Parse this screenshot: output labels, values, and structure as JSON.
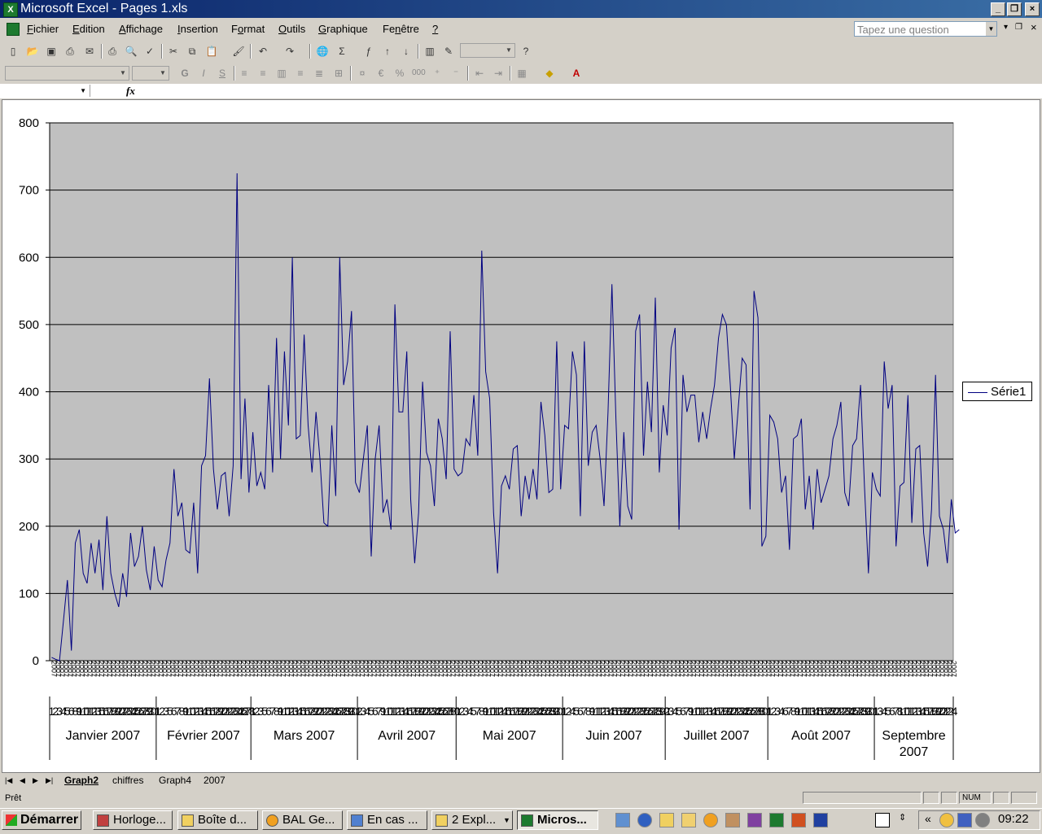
{
  "window": {
    "title": "Microsoft Excel - Pages 1.xls",
    "app_icon": "excel-icon"
  },
  "menu": {
    "items": [
      {
        "label": "Fichier",
        "hot": "F"
      },
      {
        "label": "Edition",
        "hot": "E"
      },
      {
        "label": "Affichage",
        "hot": "A"
      },
      {
        "label": "Insertion",
        "hot": "I"
      },
      {
        "label": "Format",
        "hot": "o"
      },
      {
        "label": "Outils",
        "hot": "O"
      },
      {
        "label": "Graphique",
        "hot": "G"
      },
      {
        "label": "Fenêtre",
        "hot": "n"
      },
      {
        "label": "?",
        "hot": "?"
      }
    ],
    "help_placeholder": "Tapez une question"
  },
  "format_toolbar": {
    "bold": "G",
    "italic": "I",
    "underline": "S",
    "euro": "€",
    "percent": "%",
    "thousands": "000"
  },
  "formula_bar": {
    "fx": "fx"
  },
  "sheet_tabs": [
    "Graph2",
    "chiffres",
    "Graph4",
    "2007"
  ],
  "active_tab": "Graph2",
  "status": {
    "text": "Prêt",
    "num": "NUM"
  },
  "taskbar": {
    "start": "Démarrer",
    "buttons": [
      "Horloge...",
      "Boîte d...",
      "BAL Ge...",
      "En cas ...",
      "2 Expl...",
      "Micros..."
    ],
    "clock": "09:22"
  },
  "chart_data": {
    "type": "line",
    "legend_position": "right",
    "grid": true,
    "ylim": [
      0,
      800
    ],
    "yticks": [
      0,
      100,
      200,
      300,
      400,
      500,
      600,
      700,
      800
    ],
    "months": [
      "Janvier 2007",
      "Février 2007",
      "Mars 2007",
      "Avril 2007",
      "Mai 2007",
      "Juin 2007",
      "Juillet 2007",
      "Août 2007",
      "Septembre 2007"
    ],
    "x": [
      "2007-01-01",
      "2007-01-02",
      "2007-01-03",
      "2007-01-04",
      "2007-01-05",
      "2007-01-06",
      "2007-01-08",
      "2007-01-09",
      "2007-01-10",
      "2007-01-11",
      "2007-01-12",
      "2007-01-13",
      "2007-01-15",
      "2007-01-16",
      "2007-01-17",
      "2007-01-18",
      "2007-01-19",
      "2007-01-20",
      "2007-01-22",
      "2007-01-23",
      "2007-01-24",
      "2007-01-25",
      "2007-01-26",
      "2007-01-27",
      "2007-01-29",
      "2007-01-30",
      "2007-01-31",
      "2007-02-01",
      "2007-02-02",
      "2007-02-03",
      "2007-02-05",
      "2007-02-06",
      "2007-02-07",
      "2007-02-08",
      "2007-02-09",
      "2007-02-10",
      "2007-02-12",
      "2007-02-13",
      "2007-02-14",
      "2007-02-15",
      "2007-02-16",
      "2007-02-17",
      "2007-02-19",
      "2007-02-20",
      "2007-02-21",
      "2007-02-22",
      "2007-02-23",
      "2007-02-24",
      "2007-02-26",
      "2007-02-27",
      "2007-02-28",
      "2007-03-01",
      "2007-03-02",
      "2007-03-03",
      "2007-03-05",
      "2007-03-06",
      "2007-03-07",
      "2007-03-08",
      "2007-03-09",
      "2007-03-10",
      "2007-03-12",
      "2007-03-13",
      "2007-03-14",
      "2007-03-15",
      "2007-03-16",
      "2007-03-17",
      "2007-03-19",
      "2007-03-20",
      "2007-03-21",
      "2007-03-22",
      "2007-03-23",
      "2007-03-24",
      "2007-03-26",
      "2007-03-27",
      "2007-03-28",
      "2007-03-29",
      "2007-03-30",
      "2007-03-31",
      "2007-04-02",
      "2007-04-03",
      "2007-04-04",
      "2007-04-05",
      "2007-04-06",
      "2007-04-07",
      "2007-04-09",
      "2007-04-10",
      "2007-04-11",
      "2007-04-12",
      "2007-04-13",
      "2007-04-14",
      "2007-04-16",
      "2007-04-17",
      "2007-04-18",
      "2007-04-19",
      "2007-04-20",
      "2007-04-21",
      "2007-04-23",
      "2007-04-24",
      "2007-04-25",
      "2007-04-26",
      "2007-04-27",
      "2007-04-28",
      "2007-04-30",
      "2007-05-01",
      "2007-05-02",
      "2007-05-03",
      "2007-05-04",
      "2007-05-05",
      "2007-05-07",
      "2007-05-08",
      "2007-05-09",
      "2007-05-10",
      "2007-05-11",
      "2007-05-12",
      "2007-05-14",
      "2007-05-15",
      "2007-05-16",
      "2007-05-17",
      "2007-05-18",
      "2007-05-19",
      "2007-05-21",
      "2007-05-22",
      "2007-05-23",
      "2007-05-24",
      "2007-05-25",
      "2007-05-26",
      "2007-05-28",
      "2007-05-29",
      "2007-05-30",
      "2007-05-31",
      "2007-06-01",
      "2007-06-02",
      "2007-06-04",
      "2007-06-05",
      "2007-06-06",
      "2007-06-07",
      "2007-06-08",
      "2007-06-09",
      "2007-06-11",
      "2007-06-12",
      "2007-06-13",
      "2007-06-14",
      "2007-06-15",
      "2007-06-16",
      "2007-06-18",
      "2007-06-19",
      "2007-06-20",
      "2007-06-21",
      "2007-06-22",
      "2007-06-23",
      "2007-06-25",
      "2007-06-26",
      "2007-06-27",
      "2007-06-28",
      "2007-06-29",
      "2007-06-30",
      "2007-07-02",
      "2007-07-03",
      "2007-07-04",
      "2007-07-05",
      "2007-07-06",
      "2007-07-07",
      "2007-07-09",
      "2007-07-10",
      "2007-07-11",
      "2007-07-12",
      "2007-07-13",
      "2007-07-14",
      "2007-07-16",
      "2007-07-17",
      "2007-07-18",
      "2007-07-19",
      "2007-07-20",
      "2007-07-21",
      "2007-07-23",
      "2007-07-24",
      "2007-07-25",
      "2007-07-26",
      "2007-07-27",
      "2007-07-28",
      "2007-07-30",
      "2007-07-31",
      "2007-08-01",
      "2007-08-02",
      "2007-08-03",
      "2007-08-04",
      "2007-08-06",
      "2007-08-07",
      "2007-08-08",
      "2007-08-09",
      "2007-08-10",
      "2007-08-11",
      "2007-08-13",
      "2007-08-14",
      "2007-08-15",
      "2007-08-16",
      "2007-08-17",
      "2007-08-18",
      "2007-08-20",
      "2007-08-21",
      "2007-08-22",
      "2007-08-23",
      "2007-08-24",
      "2007-08-25",
      "2007-08-27",
      "2007-08-28",
      "2007-08-29",
      "2007-08-30",
      "2007-08-31",
      "2007-09-01",
      "2007-09-03",
      "2007-09-04",
      "2007-09-05",
      "2007-09-06",
      "2007-09-07",
      "2007-09-08",
      "2007-09-10",
      "2007-09-11",
      "2007-09-12",
      "2007-09-13",
      "2007-09-14",
      "2007-09-15",
      "2007-09-17",
      "2007-09-18",
      "2007-09-19",
      "2007-09-20",
      "2007-09-21",
      "2007-09-22",
      "2007-09-24"
    ],
    "series": [
      {
        "color": "#000080",
        "values": [
          5,
          2,
          0,
          60,
          120,
          15,
          175,
          195,
          130,
          115,
          175,
          130,
          180,
          105,
          215,
          130,
          100,
          80,
          130,
          95,
          190,
          140,
          155,
          200,
          135,
          105,
          170,
          120,
          110,
          150,
          175,
          285,
          215,
          235,
          165,
          160,
          235,
          130,
          290,
          305,
          420,
          285,
          225,
          275,
          280,
          215,
          290,
          725,
          270,
          390,
          250,
          340,
          260,
          280,
          255,
          410,
          280,
          480,
          300,
          460,
          350,
          600,
          330,
          335,
          485,
          350,
          280,
          370,
          300,
          205,
          200,
          350,
          245,
          600,
          410,
          445,
          520,
          265,
          250,
          300,
          350,
          155,
          300,
          350,
          220,
          240,
          195,
          530,
          370,
          370,
          460,
          240,
          145,
          220,
          415,
          310,
          290,
          230,
          360,
          330,
          270,
          490,
          285,
          275,
          280,
          330,
          320,
          395,
          305,
          610,
          430,
          390,
          220,
          130,
          260,
          275,
          255,
          315,
          320,
          215,
          275,
          240,
          285,
          240,
          385,
          335,
          250,
          255,
          475,
          255,
          350,
          345,
          460,
          425,
          215,
          475,
          290,
          340,
          350,
          300,
          230,
          370,
          560,
          360,
          200,
          340,
          230,
          210,
          490,
          515,
          305,
          415,
          340,
          540,
          280,
          380,
          335,
          465,
          495,
          195,
          425,
          370,
          395,
          395,
          325,
          370,
          330,
          375,
          410,
          480,
          515,
          500,
          410,
          300,
          375,
          450,
          440,
          225,
          550,
          510,
          170,
          185,
          365,
          355,
          330,
          250,
          275,
          165,
          330,
          335,
          360,
          225,
          275,
          195,
          285,
          235,
          255,
          275,
          330,
          350,
          385,
          250,
          230,
          320,
          330,
          410,
          260,
          130,
          280,
          255,
          245,
          445,
          375,
          410,
          170,
          260,
          265,
          395,
          205,
          315,
          320,
          190,
          140,
          225,
          425,
          215,
          195,
          145,
          240,
          190,
          195
        ]
      }
    ]
  }
}
